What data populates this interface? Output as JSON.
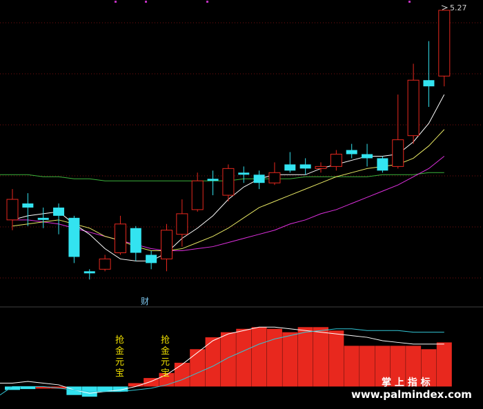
{
  "price_label": "5.27",
  "cai_label": "财",
  "signal_labels": [
    "抢",
    "金",
    "元",
    "宝"
  ],
  "watermark": {
    "line1": "掌 上 指 标",
    "line2": "www.palmindex.com"
  },
  "colors": {
    "bg": "#000000",
    "up": "#e8281e",
    "down": "#33e3f0",
    "ma_white": "#ffffff",
    "ma_yellow": "#e8e864",
    "ma_magenta": "#e030e0",
    "ma_green": "#3cb43c",
    "grid": "#7a1010",
    "signal_text": "#f0e000",
    "osc_white": "#ffffff",
    "osc_cyan": "#33c8d8"
  },
  "chart_data": {
    "type": "candlestick",
    "candles": [
      {
        "o": 4.25,
        "c": 4.35,
        "h": 4.4,
        "l": 4.2
      },
      {
        "o": 4.33,
        "c": 4.31,
        "h": 4.38,
        "l": 4.22
      },
      {
        "o": 4.26,
        "c": 4.25,
        "h": 4.31,
        "l": 4.21
      },
      {
        "o": 4.31,
        "c": 4.27,
        "h": 4.33,
        "l": 4.18
      },
      {
        "o": 4.26,
        "c": 4.07,
        "h": 4.27,
        "l": 4.04
      },
      {
        "o": 4.0,
        "c": 3.99,
        "h": 4.01,
        "l": 3.96
      },
      {
        "o": 4.01,
        "c": 4.06,
        "h": 4.08,
        "l": 4.0
      },
      {
        "o": 4.09,
        "c": 4.23,
        "h": 4.27,
        "l": 4.08
      },
      {
        "o": 4.21,
        "c": 4.09,
        "h": 4.22,
        "l": 4.05
      },
      {
        "o": 4.08,
        "c": 4.04,
        "h": 4.1,
        "l": 4.01
      },
      {
        "o": 4.06,
        "c": 4.2,
        "h": 4.23,
        "l": 4.0
      },
      {
        "o": 4.18,
        "c": 4.28,
        "h": 4.35,
        "l": 4.12
      },
      {
        "o": 4.3,
        "c": 4.44,
        "h": 4.48,
        "l": 4.29
      },
      {
        "o": 4.45,
        "c": 4.44,
        "h": 4.49,
        "l": 4.37
      },
      {
        "o": 4.37,
        "c": 4.5,
        "h": 4.52,
        "l": 4.34
      },
      {
        "o": 4.48,
        "c": 4.47,
        "h": 4.51,
        "l": 4.43
      },
      {
        "o": 4.47,
        "c": 4.43,
        "h": 4.49,
        "l": 4.4
      },
      {
        "o": 4.43,
        "c": 4.48,
        "h": 4.53,
        "l": 4.42
      },
      {
        "o": 4.52,
        "c": 4.49,
        "h": 4.58,
        "l": 4.48
      },
      {
        "o": 4.52,
        "c": 4.5,
        "h": 4.55,
        "l": 4.47
      },
      {
        "o": 4.5,
        "c": 4.51,
        "h": 4.53,
        "l": 4.48
      },
      {
        "o": 4.51,
        "c": 4.57,
        "h": 4.59,
        "l": 4.49
      },
      {
        "o": 4.59,
        "c": 4.57,
        "h": 4.62,
        "l": 4.55
      },
      {
        "o": 4.57,
        "c": 4.55,
        "h": 4.62,
        "l": 4.51
      },
      {
        "o": 4.55,
        "c": 4.49,
        "h": 4.56,
        "l": 4.48
      },
      {
        "o": 4.51,
        "c": 4.64,
        "h": 4.86,
        "l": 4.5
      },
      {
        "o": 4.66,
        "c": 4.93,
        "h": 5.01,
        "l": 4.62
      },
      {
        "o": 4.93,
        "c": 4.9,
        "h": 5.12,
        "l": 4.8
      },
      {
        "o": 4.95,
        "c": 5.27,
        "h": 5.27,
        "l": 4.9
      }
    ],
    "ma_lines": [
      {
        "name": "MA5",
        "values": [
          4.25,
          4.27,
          4.28,
          4.29,
          4.23,
          4.18,
          4.11,
          4.06,
          4.05,
          4.05,
          4.09,
          4.16,
          4.21,
          4.27,
          4.35,
          4.41,
          4.45,
          4.47,
          4.47,
          4.47,
          4.5,
          4.52,
          4.54,
          4.56,
          4.56,
          4.57,
          4.63,
          4.72,
          4.86
        ]
      },
      {
        "name": "MA10",
        "values": [
          4.22,
          4.23,
          4.24,
          4.25,
          4.23,
          4.21,
          4.17,
          4.15,
          4.12,
          4.1,
          4.1,
          4.11,
          4.14,
          4.17,
          4.21,
          4.26,
          4.31,
          4.34,
          4.37,
          4.4,
          4.43,
          4.46,
          4.48,
          4.5,
          4.51,
          4.52,
          4.55,
          4.61,
          4.69
        ]
      },
      {
        "name": "MA30",
        "values": [
          4.25,
          4.25,
          4.24,
          4.23,
          4.21,
          4.19,
          4.17,
          4.15,
          4.13,
          4.11,
          4.1,
          4.1,
          4.11,
          4.12,
          4.14,
          4.16,
          4.18,
          4.2,
          4.23,
          4.25,
          4.28,
          4.3,
          4.33,
          4.36,
          4.39,
          4.42,
          4.46,
          4.5,
          4.56
        ]
      },
      {
        "name": "MA60",
        "values": [
          4.47,
          4.47,
          4.46,
          4.46,
          4.45,
          4.45,
          4.44,
          4.44,
          4.44,
          4.44,
          4.44,
          4.44,
          4.44,
          4.44,
          4.44,
          4.45,
          4.45,
          4.45,
          4.45,
          4.46,
          4.46,
          4.46,
          4.46,
          4.46,
          4.47,
          4.47,
          4.47,
          4.48,
          4.48
        ]
      }
    ],
    "ylim": [
      3.85,
      5.3
    ],
    "oscillator": {
      "bars": [
        -0.2,
        -0.15,
        0,
        0,
        -0.5,
        -0.6,
        -0.3,
        -0.3,
        0.2,
        0.5,
        0.8,
        1.4,
        2.2,
        2.9,
        3.2,
        3.4,
        3.5,
        3.4,
        3.2,
        3.5,
        3.5,
        3.3,
        2.4,
        2.4,
        2.4,
        2.4,
        2.4,
        2.2,
        2.6
      ],
      "line_white": [
        0.2,
        0.3,
        0.2,
        0.1,
        -0.2,
        -0.4,
        -0.3,
        -0.2,
        0.0,
        0.3,
        0.7,
        1.3,
        2.0,
        2.7,
        3.1,
        3.3,
        3.5,
        3.5,
        3.4,
        3.3,
        3.2,
        3.1,
        3.0,
        2.9,
        2.7,
        2.6,
        2.5,
        2.5,
        2.5
      ],
      "line_cyan": [
        0.0,
        0.0,
        0.0,
        -0.1,
        -0.2,
        -0.3,
        -0.3,
        -0.3,
        -0.2,
        -0.1,
        0.1,
        0.4,
        0.8,
        1.2,
        1.7,
        2.1,
        2.5,
        2.8,
        3.0,
        3.2,
        3.3,
        3.4,
        3.4,
        3.3,
        3.3,
        3.3,
        3.2,
        3.2,
        3.2
      ],
      "ylim": [
        -1.0,
        4.0
      ]
    }
  }
}
